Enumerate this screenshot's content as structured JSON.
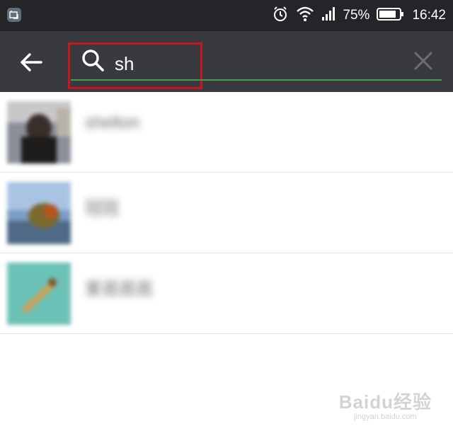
{
  "status_bar": {
    "battery_percent": "75%",
    "time": "16:42",
    "icons": [
      "screenshot-app-icon",
      "alarm-icon",
      "wifi-icon",
      "signal-icon",
      "battery-icon"
    ]
  },
  "search": {
    "query": "sh"
  },
  "results": [
    {
      "name": "shelton",
      "avatar": "avatar-photo-person"
    },
    {
      "name": "冠冠",
      "avatar": "avatar-photo-outdoor"
    },
    {
      "name": "爱逛逛逛",
      "avatar": "avatar-photo-teal"
    }
  ],
  "watermark": {
    "brand": "Baidu经验",
    "url": "jingyan.baidu.com"
  },
  "colors": {
    "status_bar": "#252529",
    "top_bar": "#393a3f",
    "highlight_box": "#c8161d",
    "search_underline": "#3ea14a"
  }
}
